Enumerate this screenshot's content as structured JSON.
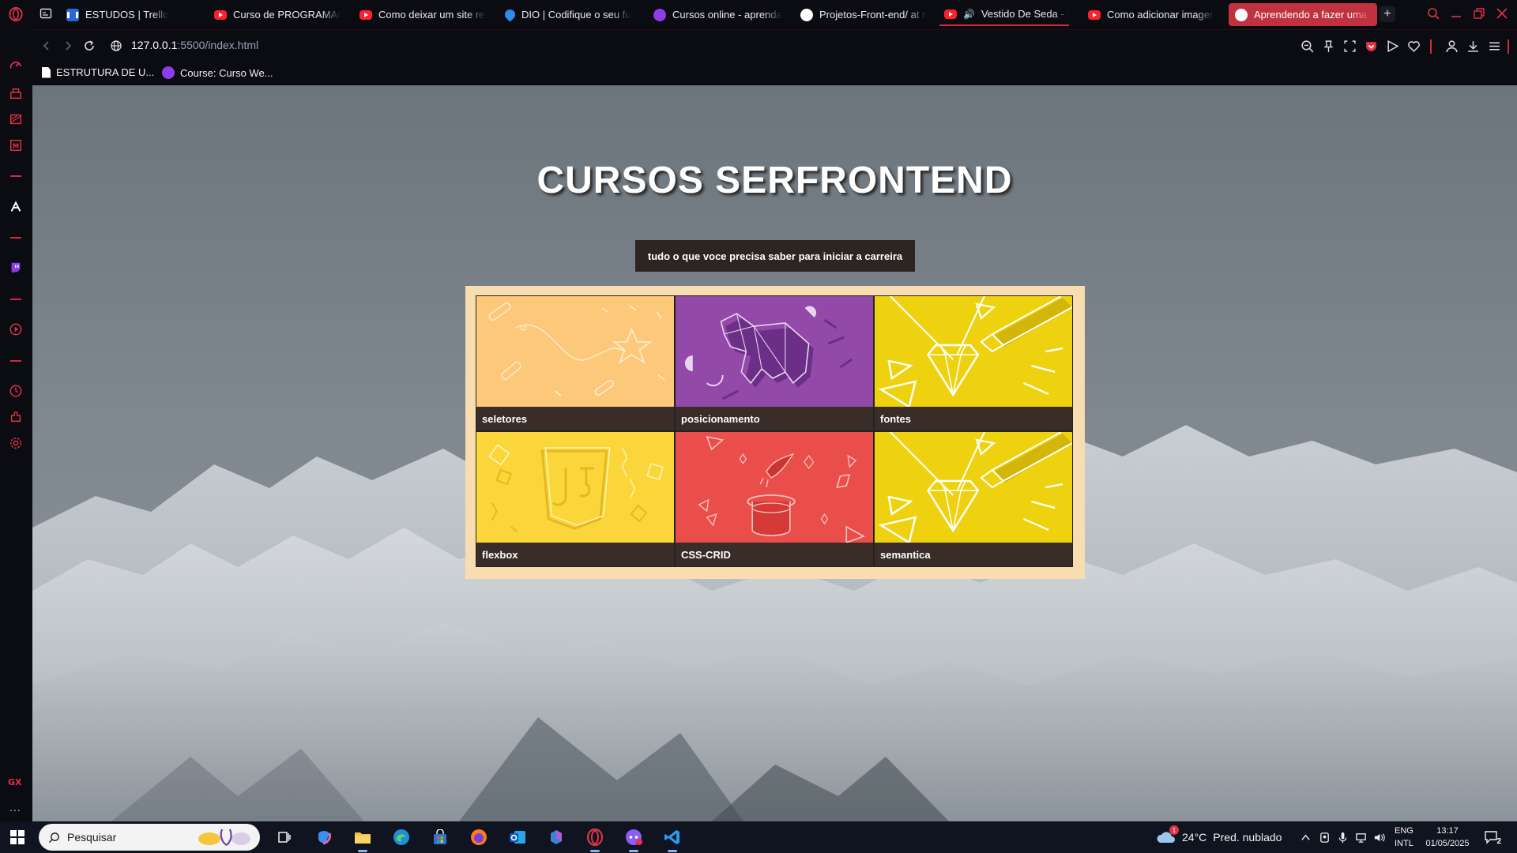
{
  "browser": {
    "tabs": [
      {
        "title": "ESTUDOS | Trello",
        "icon": "trello-icon"
      },
      {
        "title": "Curso de PROGRAMAÇÃ",
        "icon": "youtube-icon"
      },
      {
        "title": "Como deixar um site res",
        "icon": "youtube-icon"
      },
      {
        "title": "DIO | Codifique o seu fu",
        "icon": "dio-icon"
      },
      {
        "title": "Cursos online - aprenda",
        "icon": "rocketseat-icon"
      },
      {
        "title": "Projetos-Front-end/ at m",
        "icon": "github-icon"
      },
      {
        "title": "Vestido De Seda - Yo",
        "icon": "youtube-icon"
      },
      {
        "title": "Como adicionar imagem",
        "icon": "youtube-icon"
      },
      {
        "title": "Aprendendo a fazer uma p",
        "icon": "globe-icon"
      }
    ],
    "url": {
      "host": "127.0.0.1",
      "path": ":5500/index.html"
    },
    "bookmarks": [
      {
        "label": "ESTRUTURA DE U...",
        "icon": "document-icon"
      },
      {
        "label": "Course: Curso We...",
        "icon": "rocketseat-icon"
      }
    ],
    "sidebar_badge": "GX",
    "sidebar_more": "..."
  },
  "page": {
    "title": "CURSOS SERFRONTEND",
    "subtitle": "tudo o que voce precisa saber para iniciar a carreira",
    "cards": [
      {
        "label": "seletores",
        "color": "#fdc87a"
      },
      {
        "label": "posicionamento",
        "color": "#9249a8"
      },
      {
        "label": "fontes",
        "color": "#efd20f"
      },
      {
        "label": "flexbox",
        "color": "#fbd63b"
      },
      {
        "label": "CSS-CRID",
        "color": "#e94e4b"
      },
      {
        "label": "semantica",
        "color": "#efd20f"
      }
    ]
  },
  "taskbar": {
    "search_placeholder": "Pesquisar",
    "weather": {
      "temp": "24°C",
      "desc": "Pred. nublado",
      "alert": "1"
    },
    "lang": {
      "line1": "ENG",
      "line2": "INTL"
    },
    "clock": {
      "time": "13:17",
      "date": "01/05/2025"
    },
    "notifications": "2"
  },
  "colors": {
    "accent": "#d52a3c",
    "frame": "#f8ddb0",
    "label_bg": "#3a2c27",
    "subtitle_bg": "#2c2522"
  }
}
